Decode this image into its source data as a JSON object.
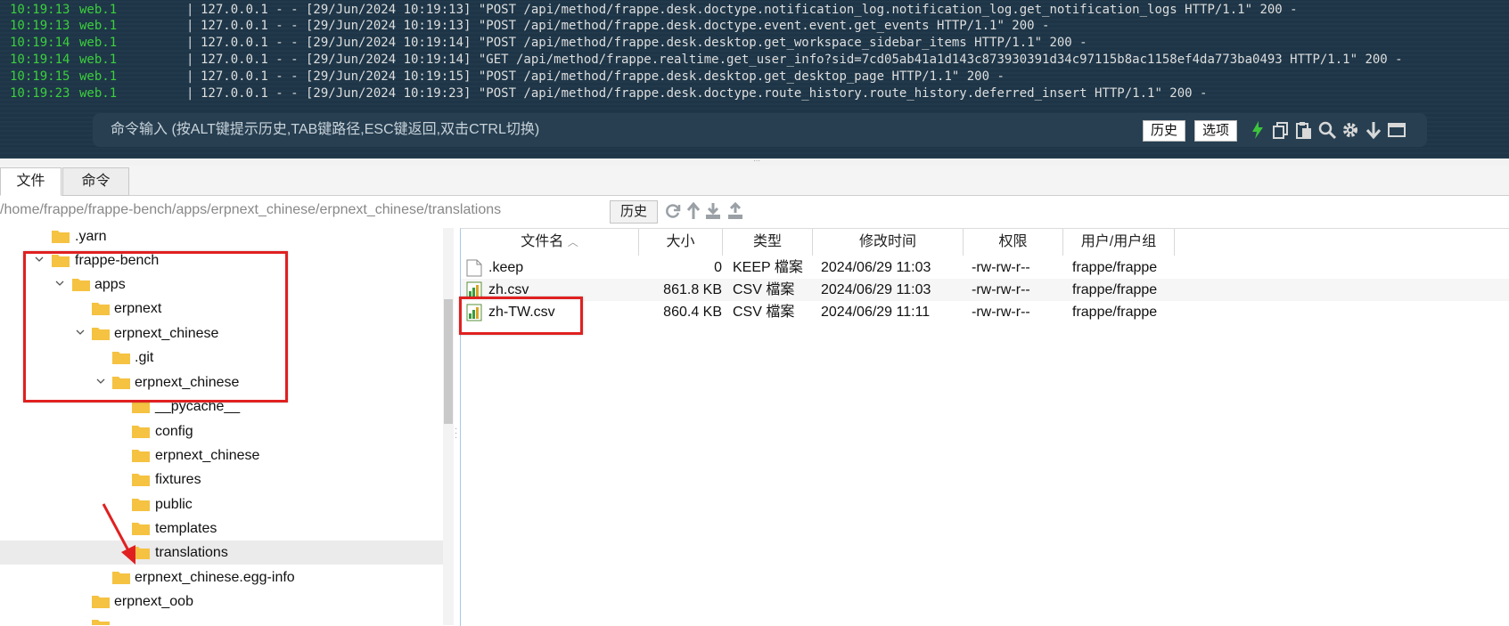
{
  "terminal": {
    "lines": [
      {
        "time": "10:19:13",
        "src": "web.1",
        "text": "127.0.0.1 - - [29/Jun/2024 10:19:13] \"POST /api/method/frappe.desk.doctype.notification_log.notification_log.get_notification_logs HTTP/1.1\" 200 -"
      },
      {
        "time": "10:19:13",
        "src": "web.1",
        "text": "127.0.0.1 - - [29/Jun/2024 10:19:13] \"POST /api/method/frappe.desk.doctype.event.event.get_events HTTP/1.1\" 200 -"
      },
      {
        "time": "10:19:14",
        "src": "web.1",
        "text": "127.0.0.1 - - [29/Jun/2024 10:19:14] \"POST /api/method/frappe.desk.desktop.get_workspace_sidebar_items HTTP/1.1\" 200 -"
      },
      {
        "time": "10:19:14",
        "src": "web.1",
        "text": "127.0.0.1 - - [29/Jun/2024 10:19:14] \"GET /api/method/frappe.realtime.get_user_info?sid=7cd05ab41a1d143c873930391d34c97115b8ac1158ef4da773ba0493 HTTP/1.1\" 200 -"
      },
      {
        "time": "10:19:15",
        "src": "web.1",
        "text": "127.0.0.1 - - [29/Jun/2024 10:19:15] \"POST /api/method/frappe.desk.desktop.get_desktop_page HTTP/1.1\" 200 -"
      },
      {
        "time": "10:19:23",
        "src": "web.1",
        "text": "127.0.0.1 - - [29/Jun/2024 10:19:23] \"POST /api/method/frappe.desk.doctype.route_history.route_history.deferred_insert HTTP/1.1\" 200 -"
      }
    ],
    "separator": "|",
    "command_placeholder": "命令输入 (按ALT键提示历史,TAB键路径,ESC键返回,双击CTRL切换)",
    "history_button": "历史",
    "options_button": "选项",
    "toolbar_icons": [
      "lightning-icon",
      "copy-icon",
      "paste-icon",
      "search-icon",
      "gear-icon",
      "download-icon",
      "maximize-icon"
    ]
  },
  "tabs": [
    {
      "label": "文件",
      "active": true
    },
    {
      "label": "命令",
      "active": false
    }
  ],
  "pathbar": {
    "path": "/home/frappe/frappe-bench/apps/erpnext_chinese/erpnext_chinese/translations",
    "history_button": "历史",
    "icons": [
      "refresh-icon",
      "up-arrow-icon",
      "download-icon",
      "upload-icon"
    ]
  },
  "tree": {
    "items": [
      {
        "label": ".yarn",
        "expanded": null,
        "selected": false
      },
      {
        "label": "frappe-bench",
        "expanded": true,
        "selected": false
      },
      {
        "label": "apps",
        "expanded": true,
        "selected": false
      },
      {
        "label": "erpnext",
        "expanded": null,
        "selected": false
      },
      {
        "label": "erpnext_chinese",
        "expanded": true,
        "selected": false
      },
      {
        "label": ".git",
        "expanded": null,
        "selected": false
      },
      {
        "label": "erpnext_chinese",
        "expanded": true,
        "selected": false
      },
      {
        "label": "__pycache__",
        "expanded": null,
        "selected": false
      },
      {
        "label": "config",
        "expanded": null,
        "selected": false
      },
      {
        "label": "erpnext_chinese",
        "expanded": null,
        "selected": false
      },
      {
        "label": "fixtures",
        "expanded": null,
        "selected": false
      },
      {
        "label": "public",
        "expanded": null,
        "selected": false
      },
      {
        "label": "templates",
        "expanded": null,
        "selected": false
      },
      {
        "label": "translations",
        "expanded": null,
        "selected": true
      },
      {
        "label": "erpnext_chinese.egg-info",
        "expanded": null,
        "selected": false
      },
      {
        "label": "erpnext_oob",
        "expanded": null,
        "selected": false
      }
    ]
  },
  "filelist": {
    "columns": [
      "文件名",
      "大小",
      "类型",
      "修改时间",
      "权限",
      "用户/用户组"
    ],
    "sort_column": "文件名",
    "rows": [
      {
        "name": ".keep",
        "size": "0",
        "type": "KEEP 檔案",
        "modified": "2024/06/29 11:03",
        "perm": "-rw-rw-r--",
        "owner": "frappe/frappe",
        "icon": "text-file-icon"
      },
      {
        "name": "zh.csv",
        "size": "861.8 KB",
        "type": "CSV 檔案",
        "modified": "2024/06/29 11:03",
        "perm": "-rw-rw-r--",
        "owner": "frappe/frappe",
        "icon": "csv-file-icon"
      },
      {
        "name": "zh-TW.csv",
        "size": "860.4 KB",
        "type": "CSV 檔案",
        "modified": "2024/06/29 11:11",
        "perm": "-rw-rw-r--",
        "owner": "frappe/frappe",
        "icon": "csv-file-icon"
      }
    ]
  },
  "colors": {
    "terminal_bg": "#1d3547",
    "log_green": "#3ccf3c",
    "folder_yellow": "#f5c242",
    "annotation_red": "#e02020",
    "accent_green": "#3cc43c"
  }
}
